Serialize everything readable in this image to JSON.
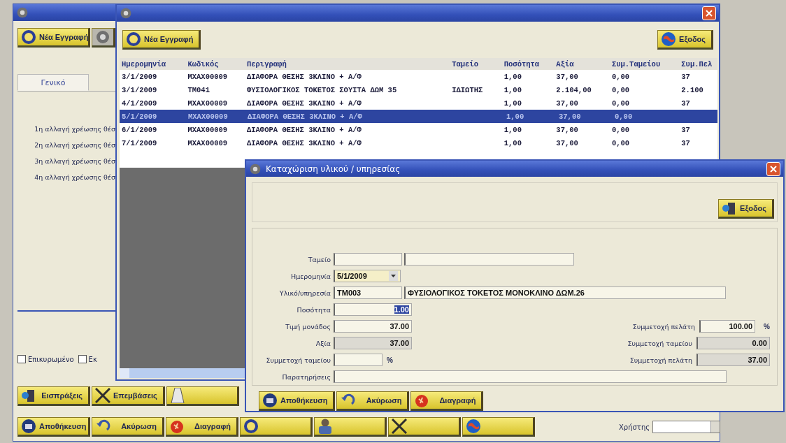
{
  "back_window": {
    "toolbar_button": "Νέα Εγγραφή",
    "tabs": [
      {
        "label": "Γενικό",
        "selected": true
      }
    ],
    "labels": [
      "1η αλλαγή χρέωσης θέσ",
      "2η αλλαγή χρέωσης θέσ",
      "3η αλλαγή χρέωσης θέσ",
      "4η αλλαγή χρέωσης θέσ"
    ],
    "checkboxes": [
      {
        "label": "Επικυρωμένο",
        "checked": false
      },
      {
        "label": "Εκ",
        "checked": false
      }
    ],
    "action_buttons": [
      {
        "kind": "labeled",
        "label": "Εισπράξεις"
      },
      {
        "kind": "labeled",
        "label": "Επεμβάσεις"
      },
      {
        "kind": "icon"
      }
    ],
    "bottom_buttons": [
      {
        "kind": "labeled",
        "label": "Αποθήκευση"
      },
      {
        "kind": "labeled",
        "label": "Ακύρωση"
      },
      {
        "kind": "labeled",
        "label": "Διαγραφή"
      },
      {
        "kind": "icon"
      },
      {
        "kind": "icon"
      },
      {
        "kind": "icon"
      },
      {
        "kind": "icon"
      }
    ],
    "user_field": {
      "label": "Χρήστης"
    }
  },
  "list_window": {
    "new_button": "Νέα Εγγραφή",
    "exit_button": "Εξοδος",
    "table": {
      "columns": [
        "Ημερομηνία",
        "Κωδικός",
        "Περιγραφή",
        "Ταμείο",
        "Ποσότητα",
        "Αξία",
        "Συμ.Ταμείου",
        "Συμ.Πελ"
      ],
      "rows": [
        {
          "selected": false,
          "cells": [
            "3/1/2009",
            "ΜΧΑΧ00009",
            "ΔΙΑΦΟΡΑ ΘΕΣΗΣ 3ΚΛΙΝΟ + Α/Φ",
            "",
            "1,00",
            "37,00",
            "0,00",
            "37"
          ]
        },
        {
          "selected": false,
          "cells": [
            "3/1/2009",
            "ΤΜ041",
            "ΦΥΣΙΟΛΟΓΙΚΟΣ ΤΟΚΕΤΟΣ ΣΟΥΙΤΑ ΔΩΜ 35",
            "ΙΔΙΩΤΗΣ",
            "1,00",
            "2.104,00",
            "0,00",
            "2.100"
          ]
        },
        {
          "selected": false,
          "cells": [
            "4/1/2009",
            "ΜΧΑΧ00009",
            "ΔΙΑΦΟΡΑ ΘΕΣΗΣ 3ΚΛΙΝΟ + Α/Φ",
            "",
            "1,00",
            "37,00",
            "0,00",
            "37"
          ]
        },
        {
          "selected": true,
          "cells": [
            "5/1/2009",
            "ΜΧΑΧ00009",
            "ΔΙΑΦΟΡΑ ΘΕΣΗΣ 3ΚΛΙΝΟ + Α/Φ",
            "",
            "1,00",
            "37,00",
            "0,00"
          ]
        },
        {
          "selected": false,
          "cells": [
            "6/1/2009",
            "ΜΧΑΧ00009",
            "ΔΙΑΦΟΡΑ ΘΕΣΗΣ 3ΚΛΙΝΟ + Α/Φ",
            "",
            "1,00",
            "37,00",
            "0,00",
            "37"
          ]
        },
        {
          "selected": false,
          "cells": [
            "7/1/2009",
            "ΜΧΑΧ00009",
            "ΔΙΑΦΟΡΑ ΘΕΣΗΣ 3ΚΛΙΝΟ + Α/Φ",
            "",
            "1,00",
            "37,00",
            "0,00",
            "37"
          ]
        }
      ]
    }
  },
  "dialog": {
    "title": "Καταχώριση υλικού / υπηρεσίας",
    "exit_button": "Εξοδος",
    "fields": [
      {
        "kind": "pair",
        "label": "Ταμείο",
        "readonly": false
      },
      {
        "kind": "date",
        "label": "Ημερομηνία",
        "value": "5/1/2009",
        "readonly": false
      },
      {
        "kind": "pair",
        "label": "Υλικό/υπηρεσία",
        "values": [
          "TM003",
          "ΦΥΣΙΟΛΟΓΙΚΟΣ ΤΟΚΕΤΟΣ ΜΟΝΟΚΛΙΝΟ ΔΩΜ.26"
        ],
        "readonly": false
      },
      {
        "kind": "number",
        "label": "Ποσότητα",
        "value": "1.00",
        "text_selected": true,
        "readonly": false
      },
      {
        "kind": "number",
        "label": "Τιμή μονάδος",
        "value": "37.00",
        "text_selected": false,
        "readonly": false
      },
      {
        "kind": "number",
        "label": "Αξία",
        "value": "37.00",
        "text_selected": false,
        "readonly": true
      },
      {
        "kind": "percent",
        "label": "Συμμετοχή ταμείου",
        "unit": "%",
        "readonly": false
      },
      {
        "kind": "text",
        "label": "Παρατηρήσεις",
        "readonly": false
      }
    ],
    "summary": [
      {
        "label": "Συμμετοχή πελάτη",
        "value": "100.00",
        "unit": "%",
        "readonly": false
      },
      {
        "label": "Συμμετοχή ταμείου",
        "value": "0.00",
        "readonly": true
      },
      {
        "label": "Συμμετοχή πελάτη",
        "value": "37.00",
        "readonly": true
      }
    ],
    "buttons": [
      "Αποθήκευση",
      "Ακύρωση",
      "Διαγραφή"
    ]
  }
}
